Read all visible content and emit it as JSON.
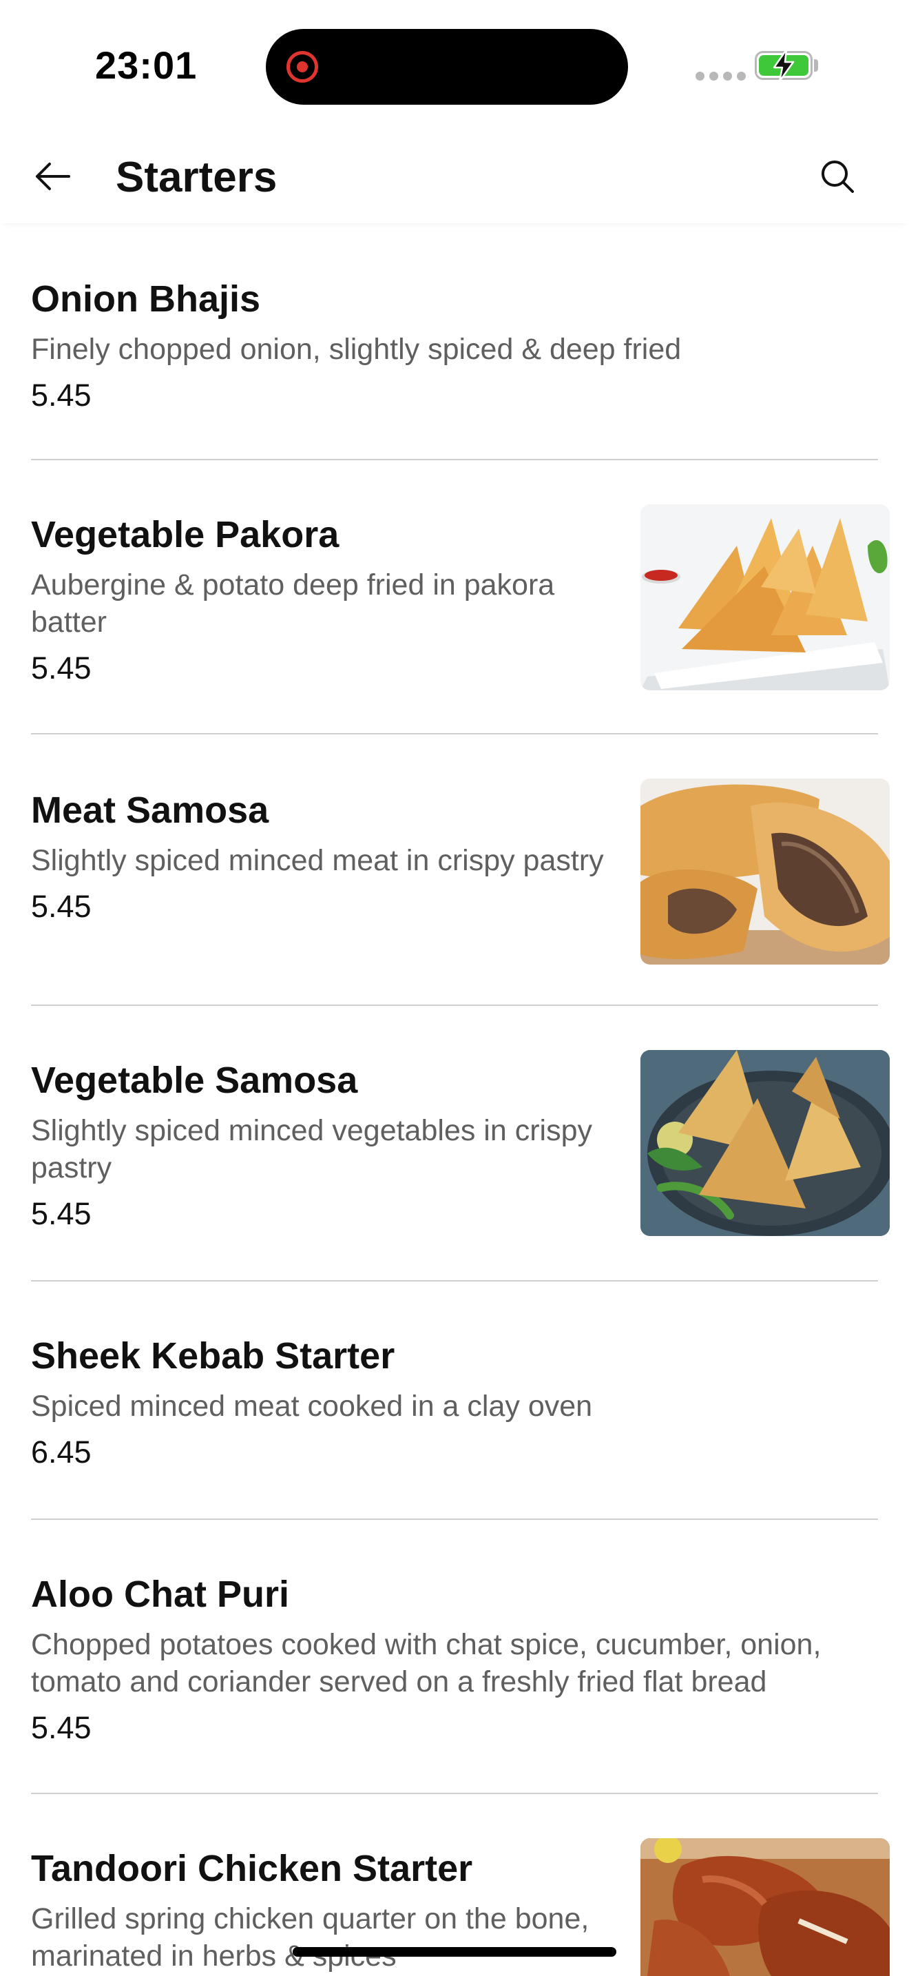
{
  "status_bar": {
    "time": "23:01"
  },
  "header": {
    "title": "Starters",
    "back_icon": "arrow-left-icon",
    "search_icon": "search-icon"
  },
  "menu": {
    "items": [
      {
        "name": "Onion Bhajis",
        "description": "Finely chopped onion, slightly spiced & deep fried",
        "price": "5.45",
        "has_image": false
      },
      {
        "name": "Vegetable Pakora",
        "description": "Aubergine & potato deep fried in pakora batter",
        "price": "5.45",
        "has_image": true
      },
      {
        "name": "Meat Samosa",
        "description": "Slightly spiced minced meat in crispy pastry",
        "price": "5.45",
        "has_image": true
      },
      {
        "name": "Vegetable Samosa",
        "description": "Slightly spiced minced vegetables in crispy pastry",
        "price": "5.45",
        "has_image": true
      },
      {
        "name": "Sheek Kebab Starter",
        "description": "Spiced minced meat cooked in a clay oven",
        "price": "6.45",
        "has_image": false
      },
      {
        "name": "Aloo Chat Puri",
        "description": "Chopped potatoes cooked with chat spice, cucumber, onion, tomato and coriander served on a freshly fried flat bread",
        "price": "5.45",
        "has_image": false
      },
      {
        "name": "Tandoori Chicken Starter",
        "description": "Grilled spring chicken quarter on the bone, marinated in herbs & spices",
        "price": "",
        "has_image": true
      }
    ]
  },
  "colors": {
    "text_primary": "#111111",
    "text_secondary": "#5f5f5f",
    "divider": "#cfcfcf",
    "battery": "#3ec83a",
    "recording": "#e0342f"
  }
}
